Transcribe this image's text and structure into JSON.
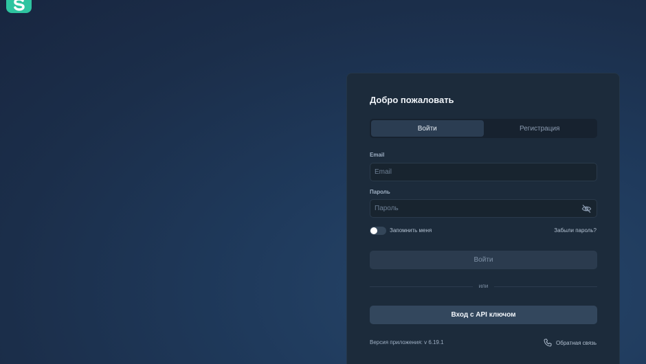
{
  "app": {
    "logo_letter": "S",
    "brand_color": "#2ec4a0"
  },
  "card": {
    "title": "Добро пожаловать",
    "tabs": [
      {
        "label": "Войти",
        "active": true
      },
      {
        "label": "Регистрация",
        "active": false
      }
    ],
    "email": {
      "label": "Email",
      "placeholder": "Email",
      "value": ""
    },
    "password": {
      "label": "Пароль",
      "placeholder": "Пароль",
      "value": "",
      "icon": "eye-off-icon"
    },
    "remember": {
      "label": "Запомнить меня",
      "checked": false
    },
    "forgot_label": "Забыли пароль?",
    "login_button": "Войти",
    "divider_text": "или",
    "api_button": "Вход с API ключом",
    "version": "Версия приложения: v 6.19.1",
    "feedback": {
      "label": "Обратная связь",
      "icon": "phone-icon"
    }
  }
}
